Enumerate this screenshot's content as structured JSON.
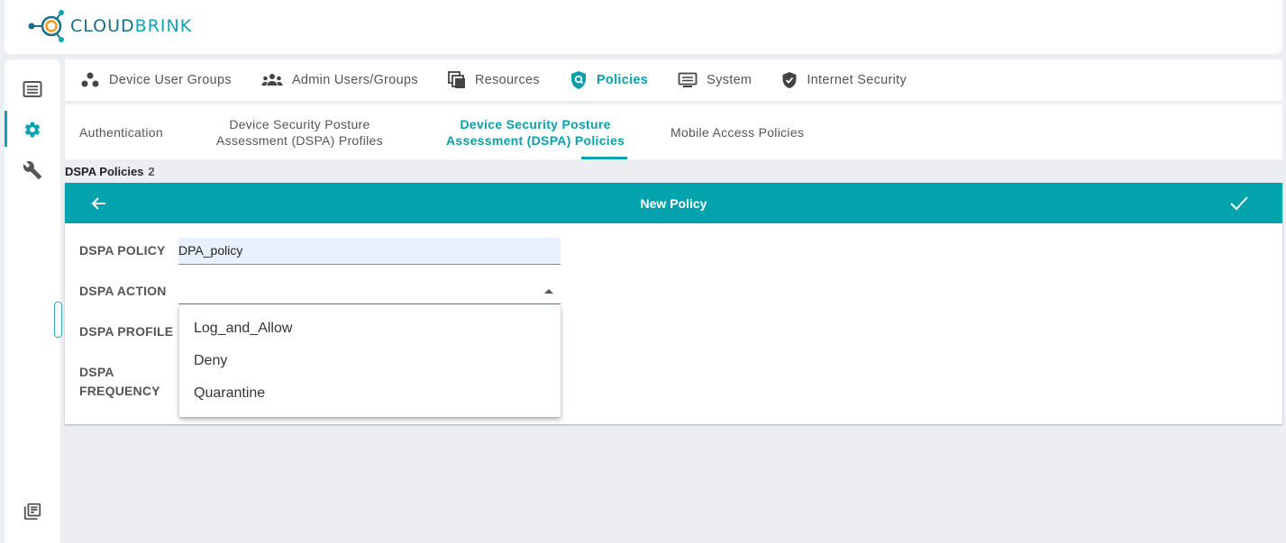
{
  "brand": {
    "name_prefix": "CLOUD",
    "name_suffix": "BRINK"
  },
  "main_tabs": [
    {
      "label": "Device User Groups",
      "icon": "groups-icon"
    },
    {
      "label": "Admin Users/Groups",
      "icon": "people-icon"
    },
    {
      "label": "Resources",
      "icon": "resources-icon"
    },
    {
      "label": "Policies",
      "icon": "policy-shield-icon",
      "active": true
    },
    {
      "label": "System",
      "icon": "system-icon"
    },
    {
      "label": "Internet Security",
      "icon": "shield-check-icon"
    }
  ],
  "sub_tabs": [
    {
      "label": "Authentication"
    },
    {
      "line1": "Device Security Posture",
      "line2": "Assessment (DSPA) Profiles"
    },
    {
      "line1": "Device Security Posture",
      "line2": "Assessment (DSPA) Policies",
      "active": true
    },
    {
      "label": "Mobile Access Policies"
    }
  ],
  "list_header": {
    "title": "DSPA Policies",
    "count": "2"
  },
  "panel": {
    "title": "New Policy",
    "fields": {
      "policy_label": "DSPA POLICY",
      "policy_value": "DPA_policy",
      "action_label": "DSPA ACTION",
      "action_value": "",
      "profile_label": "DSPA PROFILE",
      "frequency_label_1": "DSPA",
      "frequency_label_2": "FREQUENCY"
    }
  },
  "dropdown": {
    "options": [
      "Log_and_Allow",
      "Deny",
      "Quarantine"
    ]
  },
  "colors": {
    "accent": "#02a3ac",
    "brand_dark": "#1a6e85"
  }
}
